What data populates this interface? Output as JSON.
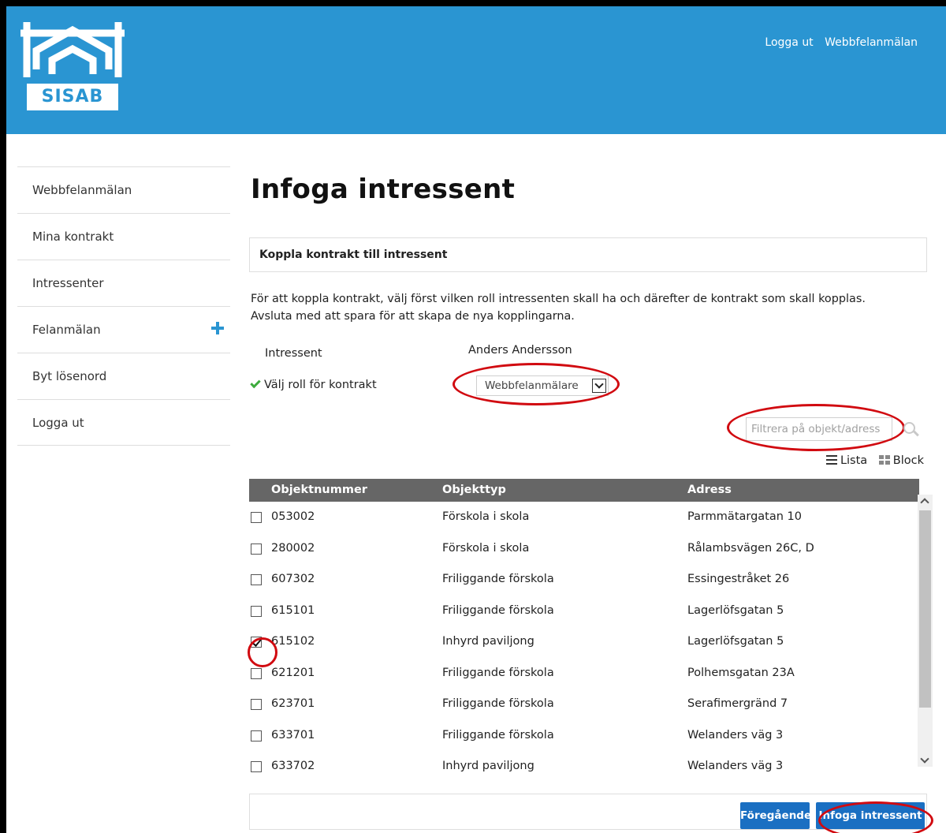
{
  "header": {
    "logo_text": "SISAB",
    "links": [
      "Logga ut",
      "Webbfelanmälan"
    ]
  },
  "sidebar": {
    "items": [
      {
        "label": "Webbfelanmälan"
      },
      {
        "label": "Mina kontrakt"
      },
      {
        "label": "Intressenter"
      },
      {
        "label": "Felanmälan",
        "icon": "plus-icon"
      },
      {
        "label": "Byt lösenord"
      },
      {
        "label": "Logga ut"
      }
    ]
  },
  "main": {
    "title": "Infoga intressent",
    "panel_heading": "Koppla kontrakt till intressent",
    "description_line1": "För att koppla kontrakt, välj först vilken roll intressenten skall ha och därefter de kontrakt som skall kopplas.",
    "description_line2": "Avsluta med att spara för att skapa de nya kopplingarna.",
    "intressent_label": "Intressent",
    "intressent_value": "Anders Andersson",
    "role_label": "Välj roll för kontrakt",
    "role_selected": "Webbfelanmälare",
    "filter_placeholder": "Filtrera på objekt/adress",
    "view_list": "Lista",
    "view_block": "Block"
  },
  "table": {
    "headers": [
      "Objektnummer",
      "Objekttyp",
      "Adress"
    ],
    "rows": [
      {
        "number": "053002",
        "type": "Förskola i skola",
        "address": "Parmmätargatan 10",
        "checked": false
      },
      {
        "number": "280002",
        "type": "Förskola i skola",
        "address": "Rålambsvägen 26C, D",
        "checked": false
      },
      {
        "number": "607302",
        "type": "Friliggande förskola",
        "address": "Essingestråket 26",
        "checked": false
      },
      {
        "number": "615101",
        "type": "Friliggande förskola",
        "address": "Lagerlöfsgatan 5",
        "checked": false
      },
      {
        "number": "615102",
        "type": "Inhyrd paviljong",
        "address": "Lagerlöfsgatan 5",
        "checked": true
      },
      {
        "number": "621201",
        "type": "Friliggande förskola",
        "address": "Polhemsgatan 23A",
        "checked": false
      },
      {
        "number": "623701",
        "type": "Friliggande förskola",
        "address": "Serafimergränd 7",
        "checked": false
      },
      {
        "number": "633701",
        "type": "Friliggande förskola",
        "address": "Welanders väg 3",
        "checked": false
      },
      {
        "number": "633702",
        "type": "Inhyrd paviljong",
        "address": "Welanders väg 3",
        "checked": false
      }
    ]
  },
  "footer": {
    "prev_button": "Föregående",
    "insert_button": "Infoga intressent"
  },
  "colors": {
    "header_bg": "#2a95d2",
    "button_bg": "#1a6fc2",
    "table_head_bg": "#666666",
    "annotation_red": "#d10a10",
    "check_green": "#3dab3d"
  }
}
